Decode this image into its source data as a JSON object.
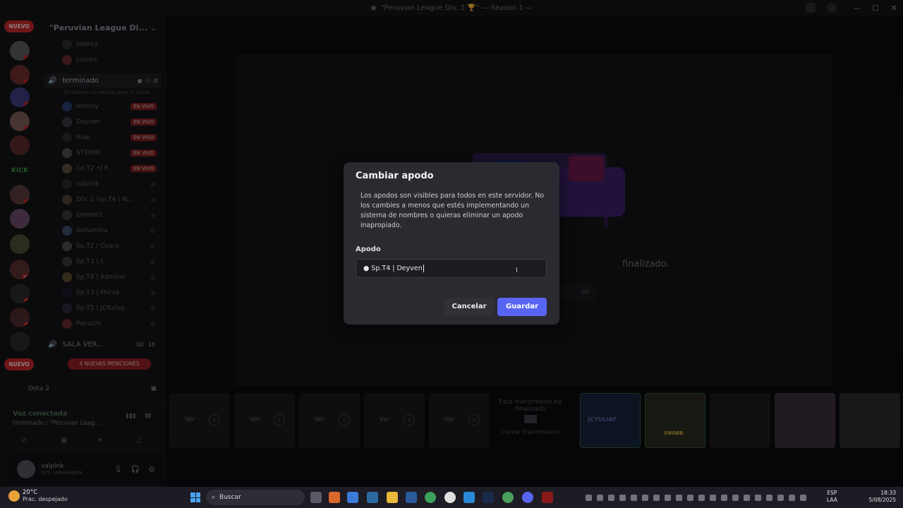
{
  "window": {
    "title": "\"Peruvian League Div. 2 🏆\" — Season 1 —"
  },
  "rail": {
    "new_top": "NUEVO",
    "new_bottom": "NUEVO",
    "kick_label": "KICK",
    "badges": [
      "8",
      "6",
      "5",
      "3",
      "5",
      "181",
      "22",
      "24"
    ]
  },
  "server": {
    "name": "\"Peruvian League Di...",
    "top_users": [
      "lowkey",
      "Luisito"
    ],
    "voice_channel": "terminado",
    "voice_status_prompt": "Establecer un estado para el canal",
    "members": [
      {
        "name": "Antony",
        "live": "EN VIVO"
      },
      {
        "name": "Deyven",
        "live": "EN VIVO"
      },
      {
        "name": "Ruar",
        "live": "EN VIVO"
      },
      {
        "name": "STEWIE",
        "live": "EN VIVO"
      },
      {
        "name": "Co.T2 •| P...",
        "live": "EN VIVO"
      },
      {
        "name": "valpink",
        "live": ""
      },
      {
        "name": "DIV. 1 |sp.T4 | N...",
        "live": ""
      },
      {
        "name": "Demon1",
        "live": ""
      },
      {
        "name": "Sehumilla",
        "live": ""
      },
      {
        "name": "Sp.T2 | Ozaru",
        "live": ""
      },
      {
        "name": "Sp.T3 | L",
        "live": ""
      },
      {
        "name": "Sp.T4 | Admiral",
        "live": ""
      },
      {
        "name": "Sp.T3 | Miirza",
        "live": ""
      },
      {
        "name": "Sp.T5 | JCYuliay",
        "live": ""
      },
      {
        "name": "Papuchi",
        "live": ""
      }
    ],
    "other_voice_channel": "SALA VER...",
    "other_voice_counts": [
      "00",
      "18"
    ],
    "mentions_pill": "4 NUEVAS MENCIONES",
    "game_label": "Dota 2"
  },
  "voice_panel": {
    "status": "Voz conectada",
    "channel": "terminado / \"Peruvian Leag..."
  },
  "user": {
    "name": "valpink",
    "status": "kick.com/valpink"
  },
  "stream": {
    "ended_text": "finalizado.",
    "hidden_button_fragment": "ón"
  },
  "tiles": {
    "view_label": "Ver",
    "ended_tile_text": "Esta transmisión ha finalizado",
    "close_stream": "Cerrar transmisión",
    "thumb_texts": [
      "JCYULIAY",
      "SNOBB"
    ]
  },
  "modal": {
    "title": "Cambiar apodo",
    "description": "Los apodos son visibles para todos en este servidor. No los cambies a menos que estés implementando un sistema de nombres o quieras eliminar un apodo inapropiado.",
    "field_label": "Apodo",
    "field_value": "● Sp.T4 | Deyven",
    "cancel": "Cancelar",
    "save": "Guardar"
  },
  "taskbar": {
    "temperature": "20°C",
    "weather_text": "Prac. despejado",
    "search_placeholder": "Buscar",
    "lang_top": "ESP",
    "lang_bottom": "LAA",
    "time": "18:33",
    "date": "5/08/2025"
  },
  "colors": {
    "accent": "#5865f2",
    "live_badge": "#7d1e1e",
    "new_pill": "#c0262a"
  }
}
